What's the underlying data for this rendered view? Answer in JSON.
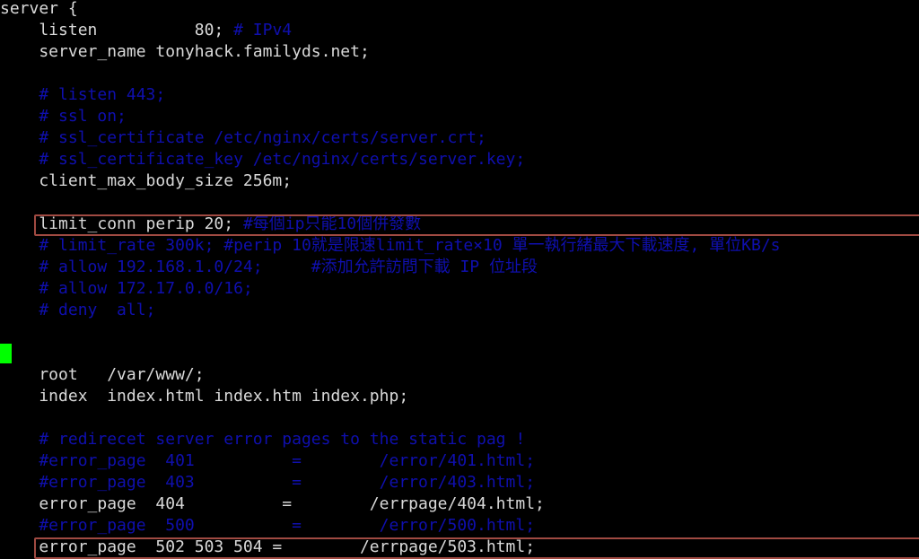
{
  "window": {
    "app": "terminal-text-editor",
    "background_color": "#000000",
    "foreground_color": "#d9d9d9",
    "comment_color": "#0f0fae",
    "highlight_box_color": "#a04a42",
    "cursor_color": "#00ff00"
  },
  "file": {
    "type": "nginx-config",
    "lines": [
      {
        "n": 1,
        "text": "server {",
        "kind": "code"
      },
      {
        "n": 2,
        "text": "    listen          80; ",
        "kind": "code",
        "comment": "# IPv4"
      },
      {
        "n": 3,
        "text": "    server_name tonyhack.familyds.net;",
        "kind": "code"
      },
      {
        "n": 4,
        "text": "",
        "kind": "blank"
      },
      {
        "n": 5,
        "text": "    # listen 443;",
        "kind": "comment"
      },
      {
        "n": 6,
        "text": "    # ssl on;",
        "kind": "comment"
      },
      {
        "n": 7,
        "text": "    # ssl_certificate /etc/nginx/certs/server.crt;",
        "kind": "comment"
      },
      {
        "n": 8,
        "text": "    # ssl_certificate_key /etc/nginx/certs/server.key;",
        "kind": "comment"
      },
      {
        "n": 9,
        "text": "    client_max_body_size 256m;",
        "kind": "code"
      },
      {
        "n": 10,
        "text": "",
        "kind": "blank"
      },
      {
        "n": 11,
        "text": "    limit_conn perip 20; ",
        "kind": "code",
        "comment": "#每個ip只能10個併發數",
        "boxed": true
      },
      {
        "n": 12,
        "text": "    # limit_rate 300k; #perip 10就是限速limit_rate×10 單一執行緒最大下載速度, 單位KB/s",
        "kind": "comment"
      },
      {
        "n": 13,
        "text": "    # allow 192.168.1.0/24;     #添加允許訪問下載 IP 位址段",
        "kind": "comment"
      },
      {
        "n": 14,
        "text": "    # allow 172.17.0.0/16;",
        "kind": "comment"
      },
      {
        "n": 15,
        "text": "    # deny  all;",
        "kind": "comment"
      },
      {
        "n": 16,
        "text": "",
        "kind": "blank"
      },
      {
        "n": 17,
        "text": "",
        "kind": "blank",
        "cursor": true
      },
      {
        "n": 18,
        "text": "    root   /var/www/;",
        "kind": "code"
      },
      {
        "n": 19,
        "text": "    index  index.html index.htm index.php;",
        "kind": "code"
      },
      {
        "n": 20,
        "text": "",
        "kind": "blank"
      },
      {
        "n": 21,
        "text": "    # redirecet server error pages to the static pag !",
        "kind": "comment"
      },
      {
        "n": 22,
        "text": "    #error_page  401          =        /error/401.html;",
        "kind": "comment"
      },
      {
        "n": 23,
        "text": "    #error_page  403          =        /error/403.html;",
        "kind": "comment"
      },
      {
        "n": 24,
        "text": "    error_page  404          =        /errpage/404.html;",
        "kind": "code"
      },
      {
        "n": 25,
        "text": "    #error_page  500          =        /error/500.html;",
        "kind": "comment"
      },
      {
        "n": 26,
        "text": "    error_page  502 503 504 =        /errpage/503.html;",
        "kind": "code",
        "boxed": true
      }
    ]
  },
  "cursor": {
    "visible": true,
    "column": 0,
    "row": 17
  }
}
